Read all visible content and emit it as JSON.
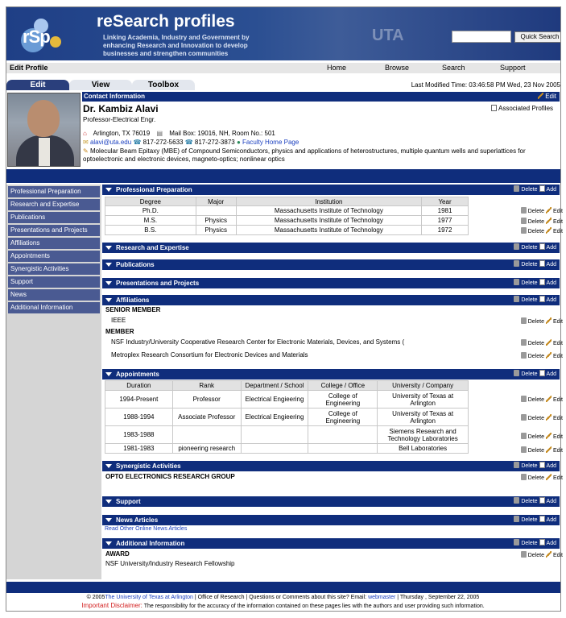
{
  "banner": {
    "logo_text": "rSp",
    "title": "reSearch profiles",
    "subtitle": "Linking Academia, Industry and Government by enhancing Research and Innovation to develop businesses and  strengthen communities",
    "watermark": "UTA",
    "search_placeholder": "",
    "search_button": "Quick Search"
  },
  "menubar": {
    "label": "Edit Profile",
    "items": [
      "Home",
      "Browse",
      "Search",
      "Support"
    ]
  },
  "tabs": [
    "Edit",
    "View",
    "Toolbox"
  ],
  "last_modified": "Last Modified Time: 03:46:58 PM Wed, 23 Nov 2005",
  "contact": {
    "header": "Contact Information",
    "edit": "Edit",
    "name": "Dr. Kambiz Alavi",
    "title": "Professor-Electrical Engr.",
    "associated": "Associated Profiles",
    "location": "Arlington, TX 76019",
    "mailbox": "Mail Box: 19016, NH, Room No.: 501",
    "email": "alavi@uta.edu",
    "phone": "817-272-5633",
    "fax": "817-272-3873",
    "homepage": "Faculty Home Page",
    "research": "Molecular Beam Epitaxy (MBE) of Compound Semiconductors, physics and applications of heterostructures, multiple quantum wells and superlattices for optoelectronic and electronic devices, magneto-optics; nonlinear optics"
  },
  "sidebar": [
    "Professional Preparation",
    "Research and Expertise",
    "Publications",
    "Presentations and Projects",
    "Affiliations",
    "Appointments",
    "Synergistic Activities",
    "Support",
    "News",
    "Additional Information"
  ],
  "actions": {
    "delete": "Delete",
    "add": "Add",
    "edit": "Edit"
  },
  "sections": {
    "prof_prep": "Professional Preparation",
    "research": "Research and Expertise",
    "publications": "Publications",
    "presentations": "Presentations and Projects",
    "affiliations": "Affiliations",
    "appointments": "Appointments",
    "synergistic": "Synergistic Activities",
    "support": "Support",
    "news": "News Articles",
    "additional": "Additional Information"
  },
  "prof_prep": {
    "headers": [
      "Degree",
      "Major",
      "Institution",
      "Year"
    ],
    "rows": [
      [
        "Ph.D.",
        "",
        "Massachusetts Institute of Technology",
        "1981"
      ],
      [
        "M.S.",
        "Physics",
        "Massachusetts Institute of Technology",
        "1977"
      ],
      [
        "B.S.",
        "Physics",
        "Massachusetts Institute of Technology",
        "1972"
      ]
    ]
  },
  "affiliations": {
    "senior_label": "SENIOR MEMBER",
    "senior_item": "IEEE",
    "member_label": "MEMBER",
    "member_items": [
      "NSF Industry/University Cooperative Research Center for Electronic Materials, Devices, and Systems (",
      "Metroplex Research Consortium for Electronic Devices and Materials"
    ]
  },
  "appointments": {
    "headers": [
      "Duration",
      "Rank",
      "Department / School",
      "College / Office",
      "University / Company"
    ],
    "rows": [
      [
        "1994-Present",
        "Professor",
        "Electrical Engieering",
        "College of Engineering",
        "University of Texas at Arlington"
      ],
      [
        "1988-1994",
        "Associate Professor",
        "Electrical Engieering",
        "College of Engineering",
        "University of Texas at Arlington"
      ],
      [
        "1983-1988",
        "",
        "",
        "",
        "Siemens Research and Technology Laboratories"
      ],
      [
        "1981-1983",
        "pioneering research",
        "",
        "",
        "Bell Laboratories"
      ]
    ]
  },
  "synergistic": {
    "item": "OPTO ELECTRONICS RESEARCH GROUP"
  },
  "news": {
    "link": "Read Other Online News Articles"
  },
  "additional": {
    "label": "AWARD",
    "item": "NSF University/Industry Research Fellowship"
  },
  "footer": {
    "copyright": "© 2005",
    "university": "The University of Texas at Arlington",
    "middle": " | Office of Research | Questions or Comments about this site? Email: ",
    "webmaster": "webmaster",
    "date": " | Thursday , September 22, 2005",
    "disclaimer_label": "Important Disclaimer:",
    "disclaimer": " The responsibility for the accuracy of the information contained on these pages lies with the authors and user providing such information."
  }
}
